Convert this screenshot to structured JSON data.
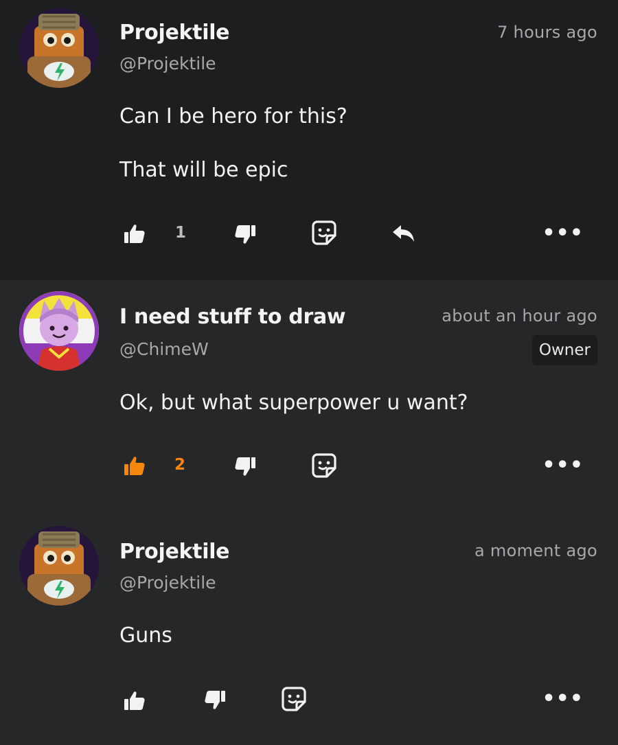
{
  "colors": {
    "accent": "#f7860d",
    "text": "#f2f2f2",
    "muted": "#a8a8ab",
    "background": "#262729",
    "highlight_background": "#1d1e20"
  },
  "comments": [
    {
      "author": "Projektile",
      "handle": "@Projektile",
      "time": "7 hours ago",
      "badge": "",
      "body": [
        "Can I be hero for this?",
        "That will be epic"
      ],
      "likes": "1",
      "liked": false,
      "avatar_icon": "robot-cat-avatar-icon",
      "actions": [
        "like-icon",
        "dislike-icon",
        "sticker-icon",
        "reply-icon",
        "more-icon"
      ]
    },
    {
      "author": "I need stuff to draw",
      "handle": "@ChimeW",
      "time": "about an hour ago",
      "badge": "Owner",
      "body": [
        "Ok, but what superpower u want?"
      ],
      "likes": "2",
      "liked": true,
      "avatar_icon": "purple-character-avatar-icon",
      "actions": [
        "like-icon",
        "dislike-icon",
        "sticker-icon",
        "more-icon"
      ]
    },
    {
      "author": "Projektile",
      "handle": "@Projektile",
      "time": "a moment ago",
      "badge": "",
      "body": [
        "Guns"
      ],
      "likes": "",
      "liked": false,
      "avatar_icon": "robot-cat-avatar-icon",
      "actions": [
        "like-icon",
        "dislike-icon",
        "sticker-icon",
        "more-icon"
      ]
    }
  ],
  "more_glyph": "•••"
}
